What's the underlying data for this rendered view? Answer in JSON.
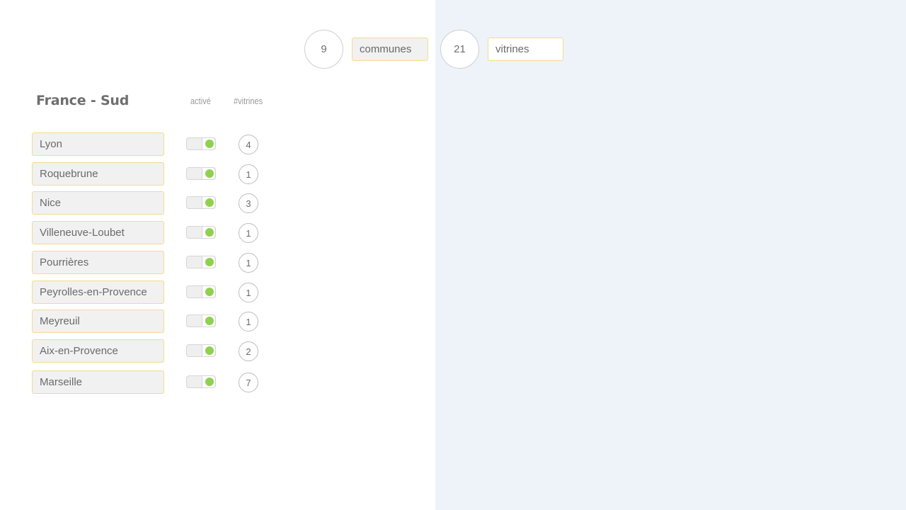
{
  "stats": {
    "communes_count": "9",
    "communes_label": "communes",
    "vitrines_count": "21",
    "vitrines_label": "vitrines"
  },
  "region": {
    "title": "France - Sud",
    "col_active": "activé",
    "col_vitrines": "#vitrines"
  },
  "communes": [
    {
      "name": "Lyon",
      "active": true,
      "vitrines": "4"
    },
    {
      "name": "Roquebrune",
      "active": true,
      "vitrines": "1"
    },
    {
      "name": "Nice",
      "active": true,
      "vitrines": "3"
    },
    {
      "name": "Villeneuve-Loubet",
      "active": true,
      "vitrines": "1"
    },
    {
      "name": "Pourrières",
      "active": true,
      "vitrines": "1"
    },
    {
      "name": "Peyrolles-en-Provence",
      "active": true,
      "vitrines": "1"
    },
    {
      "name": "Meyreuil",
      "active": true,
      "vitrines": "1"
    },
    {
      "name": "Aix-en-Provence",
      "active": true,
      "vitrines": "2"
    },
    {
      "name": "Marseille",
      "active": true,
      "vitrines": "7"
    }
  ],
  "colors": {
    "accent_border": "#f3dc8c",
    "toggle_on": "#8fd14f",
    "right_panel_bg": "#eef3fa"
  }
}
